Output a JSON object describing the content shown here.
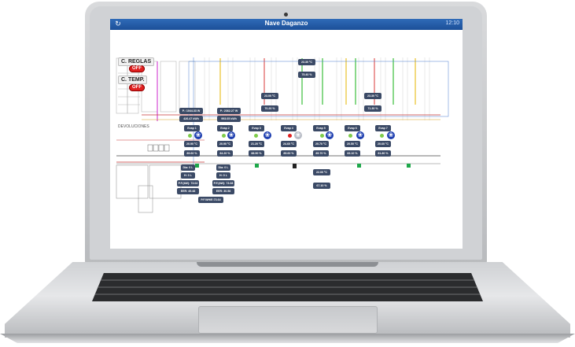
{
  "app": {
    "title": "Nave Daganzo",
    "clock": "12:10",
    "refresh_icon": "refresh-icon"
  },
  "controls": {
    "reglas_label": "C. REGLAS",
    "reglas_state": "OFF",
    "temp_label": "C. TEMP.",
    "temp_state": "OFF"
  },
  "plan_text": {
    "devoluciones": "DEVOLUCIONES"
  },
  "top_readings": {
    "t1": "23.30 ºC",
    "h1": "75.40 %",
    "t2": "23.00 ºC",
    "h2": "70.20 %",
    "t3": "23.30 ºC",
    "h3": "71.30 %"
  },
  "power": [
    {
      "p": "P.: 1044.33 W",
      "e": "426.47 kWh"
    },
    {
      "p": "P.: 2362.27 W",
      "e": "993.05 kWh"
    }
  ],
  "evaps": [
    {
      "name": "Evap 1",
      "temp": "20.90 ºC",
      "hum": "89.60 %"
    },
    {
      "name": "Evap 2",
      "temp": "20.90 ºC",
      "hum": "84.20 %"
    },
    {
      "name": "Evap 3",
      "temp": "21.20 ºC",
      "hum": "88.90 %"
    },
    {
      "name": "Evap 4",
      "temp": "24.60 ºC",
      "hum": "85.60 %"
    },
    {
      "name": "Evap 5",
      "temp": "20.70 ºC",
      "hum": "85.70 %"
    },
    {
      "name": "Evap 6",
      "temp": "20.50 ºC",
      "hum": "83.10 %"
    },
    {
      "name": "Evap 7",
      "temp": "20.60 ºC",
      "hum": "81.80 %"
    }
  ],
  "bottom_readings": {
    "t": "22.00 ºC",
    "h": "67.10 %"
  },
  "units": [
    {
      "dia": "Dia: 0 L",
      "h": "H: 0 L",
      "pf": "P.F.(kW): 73.02",
      "eer": "EER: 49.48"
    },
    {
      "dia": "Dia: 0 L",
      "h": "H: 0 L",
      "pf": "P.F.(kW): 73.08",
      "eer": "EER: 30.58"
    }
  ],
  "total": "P.F.WH/E:73.64"
}
